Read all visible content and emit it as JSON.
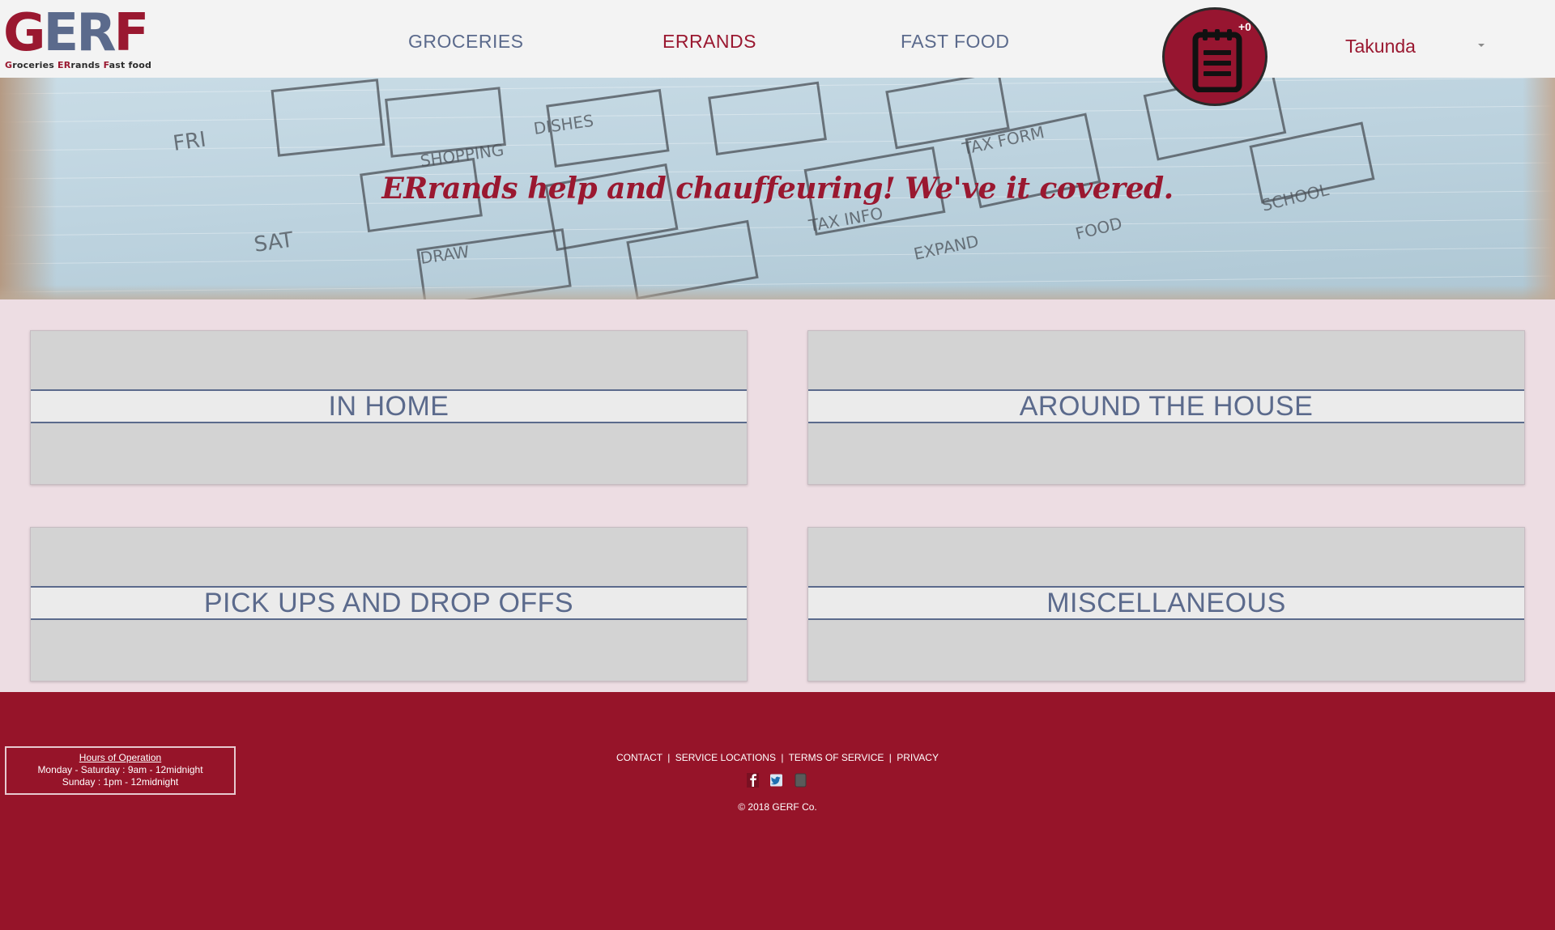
{
  "brand": {
    "logo_text": "GERF",
    "logo_sub": {
      "g1": "G",
      "g2": "roceries ",
      "e1": "ER",
      "e2": "rands ",
      "f1": "F",
      "f2": "ast food"
    }
  },
  "nav": {
    "items": [
      {
        "label": "GROCERIES",
        "color": "#5b6a8c"
      },
      {
        "label": "ERRANDS",
        "color": "#9a1830",
        "active": true
      },
      {
        "label": "FAST FOOD",
        "color": "#5b6a8c"
      }
    ],
    "cart_count": "+0",
    "user": "Takunda"
  },
  "hero": {
    "title": "ERrands help and chauffeuring! We've it covered."
  },
  "categories": [
    {
      "label": "IN HOME"
    },
    {
      "label": "AROUND THE HOUSE"
    },
    {
      "label": "PICK UPS AND DROP OFFS"
    },
    {
      "label": "MISCELLANEOUS"
    }
  ],
  "footer": {
    "hours_title": "Hours of Operation",
    "hours_weekday": "Monday - Saturday : 9am - 12midnight",
    "hours_sunday": "Sunday : 1pm - 12midnight",
    "links": [
      "CONTACT",
      "SERVICE LOCATIONS",
      "TERMS OF SERVICE",
      "PRIVACY"
    ],
    "separator": "|",
    "social_icons": [
      "facebook-icon",
      "twitter-icon",
      "instagram-icon"
    ],
    "copyright": "© 2018 GERF Co."
  },
  "colors": {
    "brand_red": "#9a1830",
    "brand_blue": "#5b6a8c",
    "footer_bg": "#961429"
  }
}
